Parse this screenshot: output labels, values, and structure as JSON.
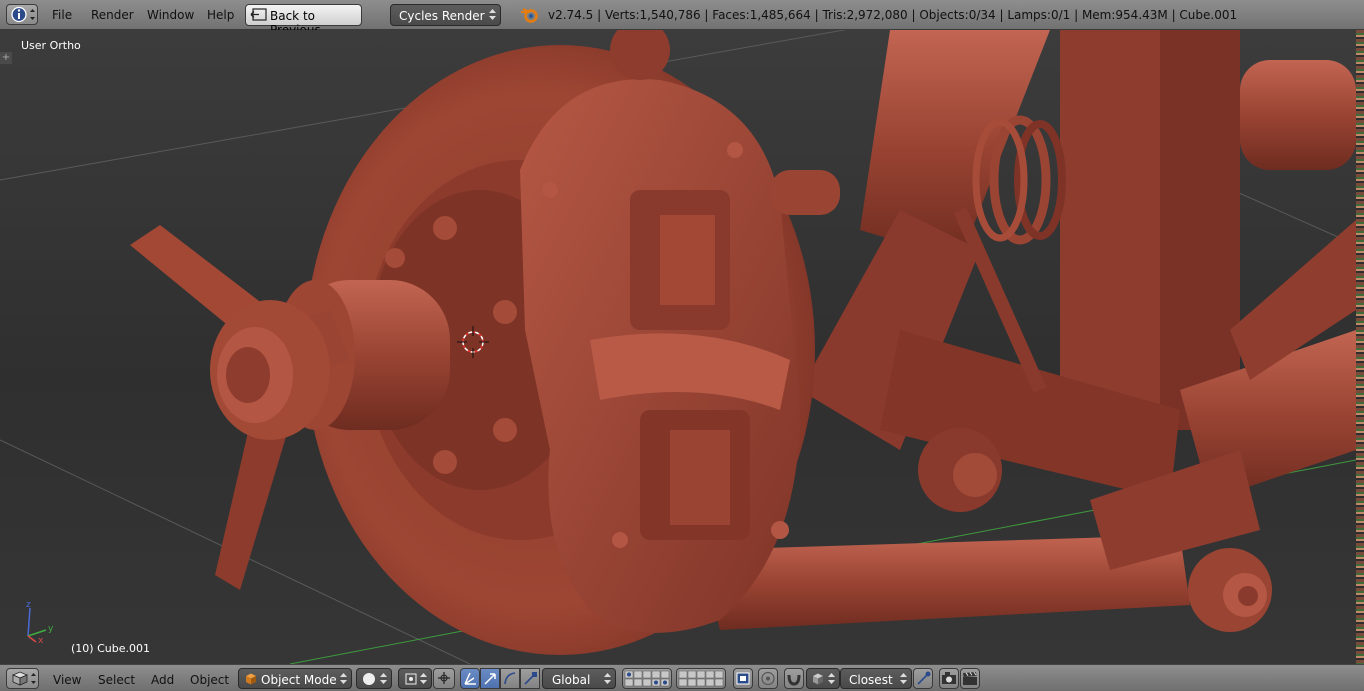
{
  "header": {
    "menus": [
      "File",
      "Render",
      "Window",
      "Help"
    ],
    "back_label": "Back to Previous",
    "render_engine": "Cycles Render",
    "stats": "v2.74.5 | Verts:1,540,786 | Faces:1,485,664 | Tris:2,972,080 | Objects:0/34 | Lamps:0/1 | Mem:954.43M | Cube.001"
  },
  "viewport": {
    "view_name": "User Ortho",
    "active_object": "(10) Cube.001",
    "axes": {
      "x": "x",
      "y": "y",
      "z": "z"
    }
  },
  "footer": {
    "menus": [
      "View",
      "Select",
      "Add",
      "Object"
    ],
    "mode": "Object Mode",
    "orientation": "Global",
    "snap_target": "Closest"
  },
  "colors": {
    "header_bg": "#808080",
    "viewport_bg": "#363636",
    "model": "#9c4a38",
    "active_blue": "#5680c2"
  }
}
